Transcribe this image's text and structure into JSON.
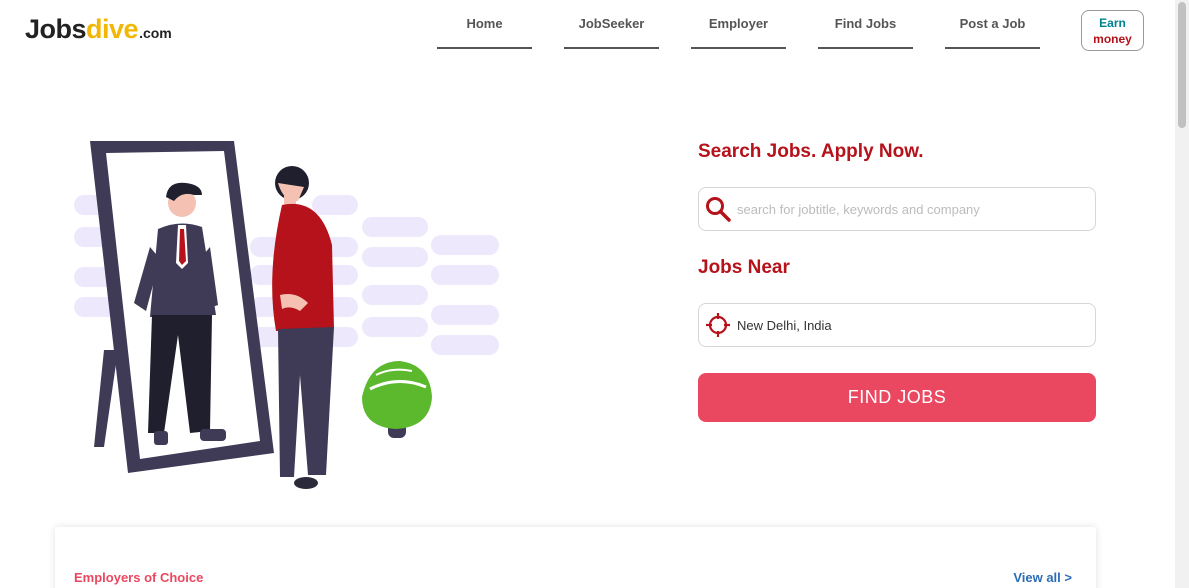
{
  "header": {
    "logo": {
      "part1": "Jobs",
      "part2": "dive",
      "part3": ".com"
    },
    "nav": [
      {
        "label": "Home"
      },
      {
        "label": "JobSeeker"
      },
      {
        "label": "Employer"
      },
      {
        "label": "Find Jobs"
      },
      {
        "label": "Post a Job"
      }
    ],
    "earn": {
      "line1": "Earn",
      "line2": "money"
    }
  },
  "search": {
    "title": "Search Jobs. Apply Now.",
    "placeholder": "search for jobtitle, keywords and company",
    "near_title": "Jobs Near",
    "location_value": "New Delhi, India",
    "button_label": "FIND JOBS"
  },
  "employers": {
    "title": "Employers of Choice",
    "view_all": "View all >"
  },
  "colors": {
    "accent": "#b5121b",
    "button": "#e94860",
    "logo_yellow": "#f2b705",
    "link": "#2a6db5"
  },
  "icons": [
    "search-icon",
    "crosshair-location-icon"
  ]
}
